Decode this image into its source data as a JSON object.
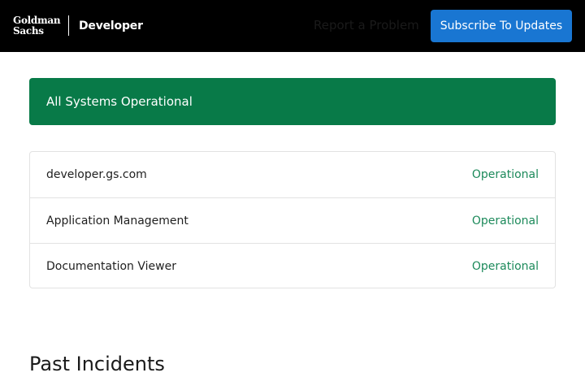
{
  "header": {
    "logo_line1": "Goldman",
    "logo_line2": "Sachs",
    "product": "Developer",
    "report_link": "Report a Problem",
    "subscribe_button": "Subscribe To Updates"
  },
  "status_banner": {
    "text": "All Systems Operational",
    "color": "#087a48"
  },
  "components": [
    {
      "name": "developer.gs.com",
      "status": "Operational"
    },
    {
      "name": "Application Management",
      "status": "Operational"
    },
    {
      "name": "Documentation Viewer",
      "status": "Operational"
    }
  ],
  "colors": {
    "header_bg": "#000000",
    "button_bg": "#1976d2",
    "operational_text": "#1d8a5b"
  },
  "past_incidents": {
    "title": "Past Incidents"
  }
}
